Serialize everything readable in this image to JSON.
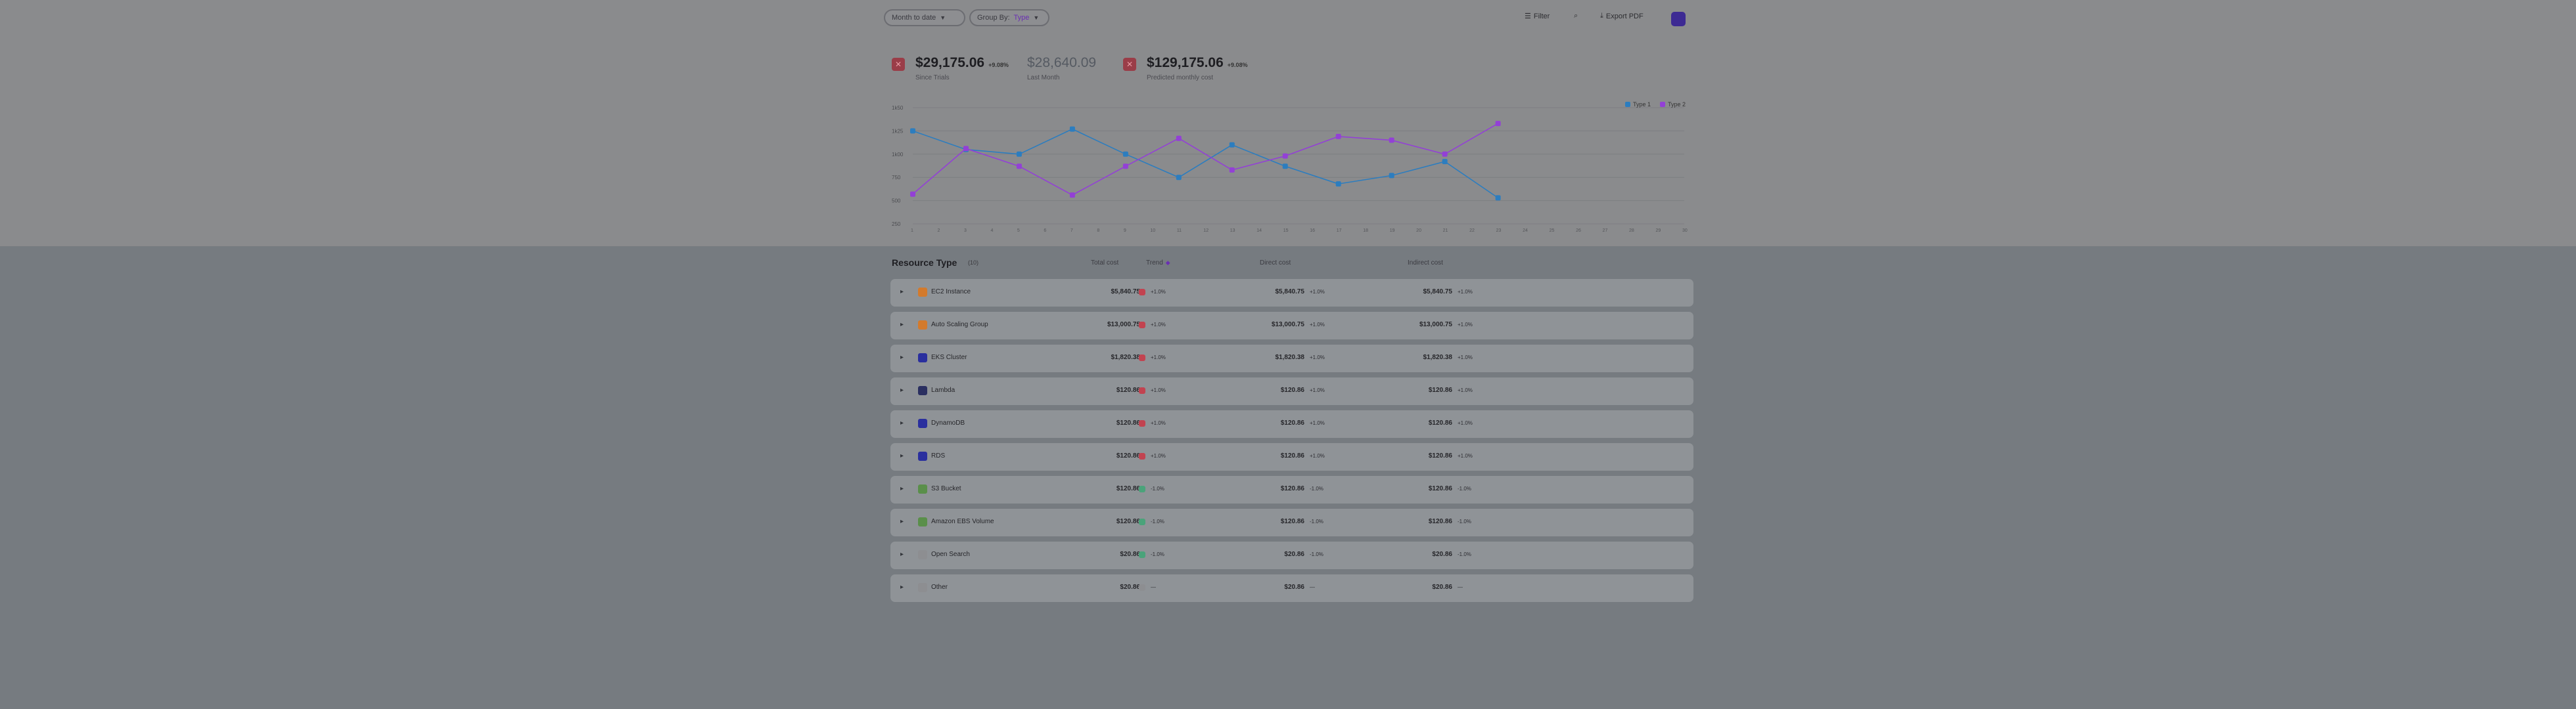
{
  "toolbar": {
    "date_filter": "Month to date",
    "group_by_label": "Group By:",
    "group_by_value": "Type",
    "filter_label": "Filter",
    "export_label": "Export PDF"
  },
  "summary": {
    "metric1": {
      "value": "$29,175.06",
      "change": "+9.08%",
      "label": "Since Trials"
    },
    "metric2": {
      "value": "$28,640.09",
      "label": "Last Month"
    },
    "metric3": {
      "value": "$129,175.06",
      "change": "+9.08%",
      "label": "Predicted monthly cost"
    }
  },
  "chart_data": {
    "type": "line",
    "legend": [
      "Type 1",
      "Type 2"
    ],
    "y_ticks": [
      "1k50",
      "1k25",
      "1k00",
      "750",
      "500",
      "250"
    ],
    "x": [
      1,
      2,
      3,
      4,
      5,
      6,
      7,
      8,
      9,
      10,
      11,
      12,
      13,
      14,
      15,
      16,
      17,
      18,
      19,
      20,
      21,
      22,
      23,
      24,
      25,
      26,
      27,
      28,
      29,
      30
    ],
    "series": [
      {
        "name": "Type 1",
        "color": "#2c7dbf",
        "points": [
          [
            1,
            1250
          ],
          [
            3,
            1050
          ],
          [
            5,
            1000
          ],
          [
            7,
            1270
          ],
          [
            9,
            1000
          ],
          [
            11,
            750
          ],
          [
            13,
            1100
          ],
          [
            15,
            870
          ],
          [
            17,
            680
          ],
          [
            19,
            770
          ],
          [
            21,
            920
          ],
          [
            23,
            530
          ]
        ]
      },
      {
        "name": "Type 2",
        "color": "#9340d6",
        "points": [
          [
            1,
            570
          ],
          [
            3,
            1060
          ],
          [
            5,
            870
          ],
          [
            7,
            560
          ],
          [
            9,
            870
          ],
          [
            11,
            1170
          ],
          [
            13,
            830
          ],
          [
            15,
            980
          ],
          [
            17,
            1190
          ],
          [
            19,
            1150
          ],
          [
            21,
            1000
          ],
          [
            23,
            1330
          ]
        ]
      }
    ]
  },
  "table": {
    "title": "Resource Type",
    "count": "(10)",
    "col_total": "Total cost",
    "col_trend": "Trend",
    "col_direct": "Direct cost",
    "col_indirect": "Indirect cost",
    "rows": [
      {
        "name": "EC2 Instance",
        "icon_color": "#d37a2c",
        "total": "$5,840.75",
        "trend": "+1.0%",
        "trend_color": "#c24350",
        "direct": "$5,840.75",
        "dchg": "+1.0%",
        "indirect": "$5,840.75",
        "ichg": "+1.0%"
      },
      {
        "name": "Auto Scaling Group",
        "icon_color": "#d37a2c",
        "total": "$13,000.75",
        "trend": "+1.0%",
        "trend_color": "#c24350",
        "direct": "$13,000.75",
        "dchg": "+1.0%",
        "indirect": "$13,000.75",
        "ichg": "+1.0%"
      },
      {
        "name": "EKS Cluster",
        "icon_color": "#2a2f9e",
        "total": "$1,820.38",
        "trend": "+1.0%",
        "trend_color": "#c24350",
        "direct": "$1,820.38",
        "dchg": "+1.0%",
        "indirect": "$1,820.38",
        "ichg": "+1.0%"
      },
      {
        "name": "Lambda",
        "icon_color": "#2a2f60",
        "total": "$120.86",
        "trend": "+1.0%",
        "trend_color": "#c24350",
        "direct": "$120.86",
        "dchg": "+1.0%",
        "indirect": "$120.86",
        "ichg": "+1.0%"
      },
      {
        "name": "DynamoDB",
        "icon_color": "#2a2f9e",
        "total": "$120.86",
        "trend": "+1.0%",
        "trend_color": "#c24350",
        "direct": "$120.86",
        "dchg": "+1.0%",
        "indirect": "$120.86",
        "ichg": "+1.0%"
      },
      {
        "name": "RDS",
        "icon_color": "#2a2f9e",
        "total": "$120.86",
        "trend": "+1.0%",
        "trend_color": "#c24350",
        "direct": "$120.86",
        "dchg": "+1.0%",
        "indirect": "$120.86",
        "ichg": "+1.0%"
      },
      {
        "name": "S3 Bucket",
        "icon_color": "#5a8f4a",
        "total": "$120.86",
        "trend": "-1.0%",
        "trend_color": "#4aa37a",
        "direct": "$120.86",
        "dchg": "-1.0%",
        "indirect": "$120.86",
        "ichg": "-1.0%"
      },
      {
        "name": "Amazon EBS Volume",
        "icon_color": "#5a8f4a",
        "total": "$120.86",
        "trend": "-1.0%",
        "trend_color": "#4aa37a",
        "direct": "$120.86",
        "dchg": "-1.0%",
        "indirect": "$120.86",
        "ichg": "-1.0%"
      },
      {
        "name": "Open Search",
        "icon_color": "#8d8e91",
        "total": "$20.86",
        "trend": "-1.0%",
        "trend_color": "#4aa37a",
        "direct": "$20.86",
        "dchg": "-1.0%",
        "indirect": "$20.86",
        "ichg": "-1.0%"
      },
      {
        "name": "Other",
        "icon_color": "#8d8e91",
        "total": "$20.86",
        "trend": "—",
        "trend_color": "#8d8e91",
        "direct": "$20.86",
        "dchg": "—",
        "indirect": "$20.86",
        "ichg": "—"
      }
    ]
  }
}
